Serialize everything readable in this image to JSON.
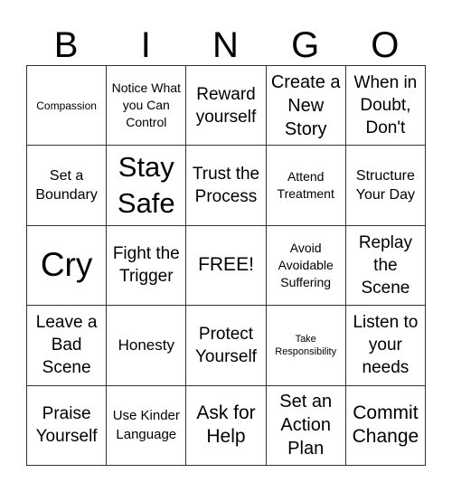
{
  "header": {
    "letters": [
      "B",
      "I",
      "N",
      "G",
      "O"
    ]
  },
  "board": {
    "cells": [
      [
        "Compassion",
        "Notice What you Can Control",
        "Reward yourself",
        "Create a New Story",
        "When in Doubt, Don't"
      ],
      [
        "Set a Boundary",
        "Stay Safe",
        "Trust the Process",
        "Attend Treatment",
        "Structure Your Day"
      ],
      [
        "Cry",
        "Fight the Trigger",
        "FREE!",
        "Avoid Avoidable Suffering",
        "Replay the Scene"
      ],
      [
        "Leave a Bad Scene",
        "Honesty",
        "Protect Yourself",
        "Take Responsibility",
        "Listen to your needs"
      ],
      [
        "Praise Yourself",
        "Use Kinder Language",
        "Ask for Help",
        "Set an Action Plan",
        "Commit Change"
      ]
    ],
    "free_space": "FREE!"
  }
}
